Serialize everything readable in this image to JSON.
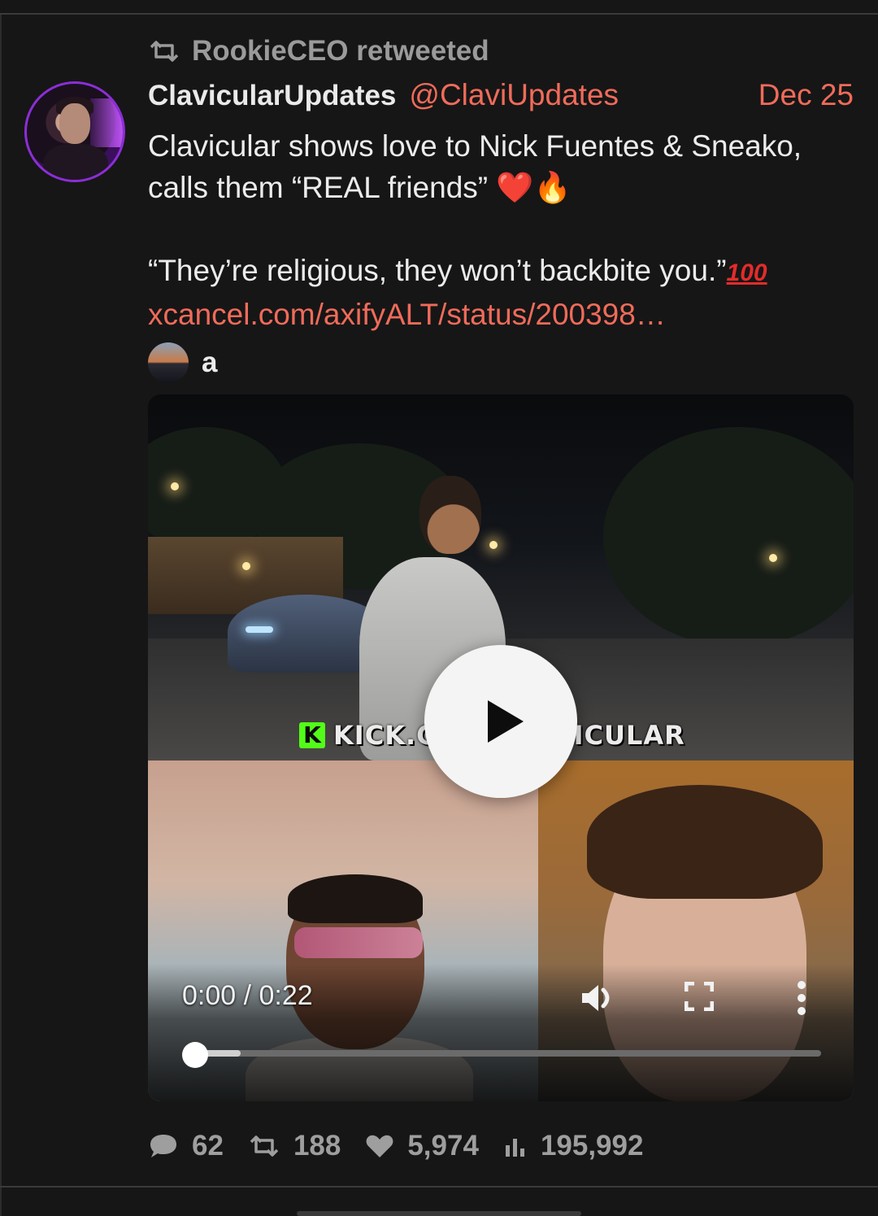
{
  "retweet": {
    "icon": "retweet-icon",
    "text": "RookieCEO retweeted"
  },
  "tweet": {
    "author": {
      "display_name": "ClavicularUpdates",
      "handle": "@ClaviUpdates",
      "avatar": "profile-avatar"
    },
    "date": "Dec 25",
    "text": {
      "line1": "Clavicular shows love to Nick Fuentes & Sneako,",
      "line2": "calls them “REAL friends”",
      "emoji_heart": "❤️",
      "emoji_fire": "🔥",
      "quote_line": "“They’re religious, they won’t backbite you.”",
      "emoji_hundred": "100",
      "link": "xcancel.com/axifyALT/status/200398…"
    }
  },
  "quoted": {
    "name": "a"
  },
  "video": {
    "watermark_letter": "K",
    "watermark": "KICK.COM/CLAVICULAR",
    "time": "0:00 / 0:22",
    "progress": 0.0
  },
  "stats": {
    "replies": "62",
    "retweets": "188",
    "likes": "5,974",
    "views": "195,992"
  },
  "colors": {
    "background": "#161616",
    "accent": "#f06b5a",
    "avatar_ring": "#8b2ed6",
    "muted": "#9e9e9e"
  }
}
